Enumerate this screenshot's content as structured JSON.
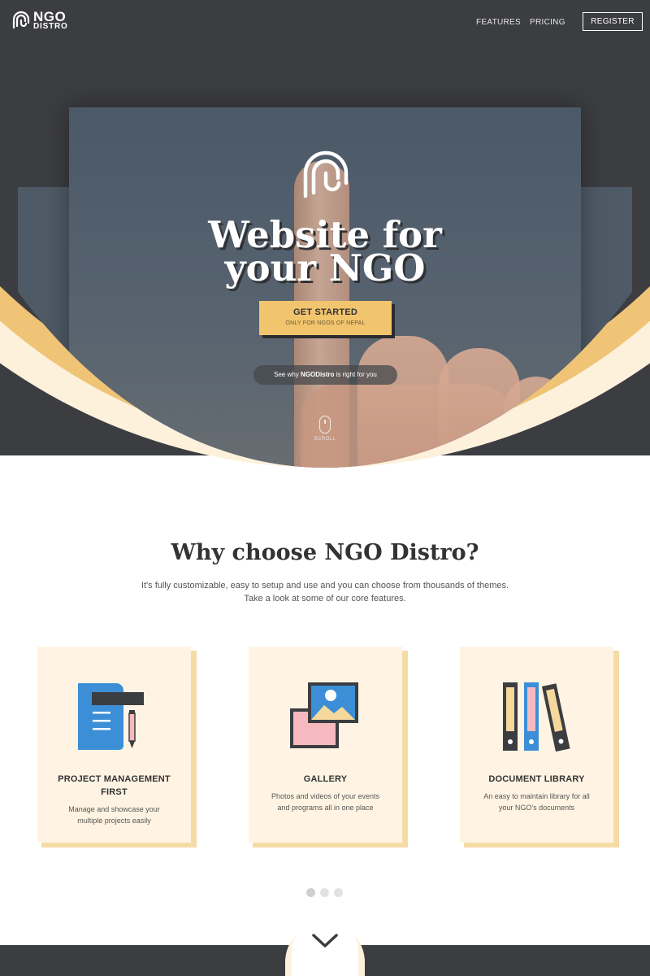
{
  "brand": {
    "name_line1": "NGO",
    "name_line2": "DISTRO"
  },
  "nav": {
    "features": "FEATURES",
    "pricing": "PRICING",
    "register": "REGISTER"
  },
  "hero": {
    "headline_line1": "Website for",
    "headline_line2": "your NGO",
    "cta_label": "GET STARTED",
    "cta_sublabel": "ONLY FOR NGOS OF NEPAL",
    "why_prefix": "See why ",
    "why_brand": "NGODistro",
    "why_suffix": " is right for you",
    "scroll_label": "SCROLL"
  },
  "features": {
    "title": "Why choose NGO Distro?",
    "subtitle_line1": "It's fully customizable, easy to setup and use and you can choose from thousands of themes.",
    "subtitle_line2": "Take a look at some of our core features.",
    "cards": [
      {
        "icon": "project-document-icon",
        "title": "PROJECT MANAGEMENT FIRST",
        "description": "Manage and showcase your multiple projects easily"
      },
      {
        "icon": "gallery-photos-icon",
        "title": "GALLERY",
        "description": "Photos and videos of your events and programs all in one place"
      },
      {
        "icon": "document-binders-icon",
        "title": "DOCUMENT LIBRARY",
        "description": "An easy to maintain library for all your NGO's documents"
      }
    ],
    "pagination": {
      "total": 3,
      "active": 1
    }
  },
  "colors": {
    "dark": "#3c3d41",
    "accent": "#f1c46e",
    "cream": "#fff4e3",
    "blue": "#3c8fd6",
    "pink": "#f6b9bf"
  }
}
